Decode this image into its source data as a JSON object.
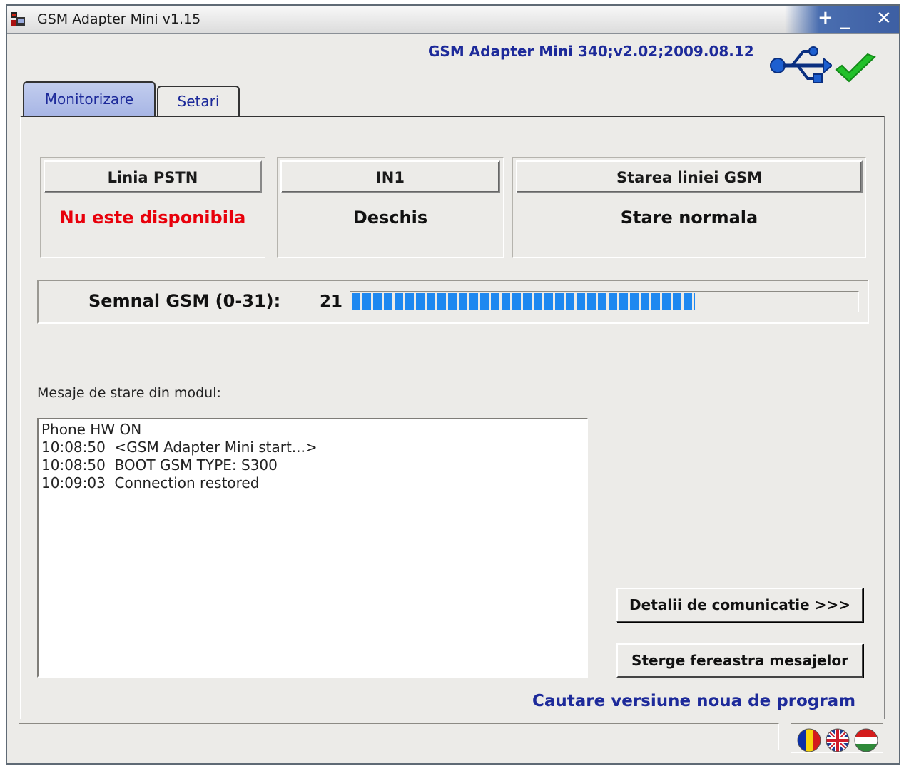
{
  "window": {
    "title": "GSM Adapter Mini v1.15",
    "controls": {
      "plus": "+",
      "minimize": "_",
      "close": "✕"
    }
  },
  "header": {
    "version_info": "GSM Adapter Mini 340;v2.02;2009.08.12",
    "connection_icon": "usb-icon",
    "status_icon": "checkmark-icon"
  },
  "tabs": [
    {
      "label": "Monitorizare",
      "active": true
    },
    {
      "label": "Setari",
      "active": false
    }
  ],
  "status_boxes": {
    "pstn": {
      "header": "Linia PSTN",
      "value": "Nu este disponibila",
      "value_color": "#e8000b"
    },
    "in1": {
      "header": "IN1",
      "value": "Deschis",
      "value_color": "#111111"
    },
    "gsm": {
      "header": "Starea liniei GSM",
      "value": "Stare normala",
      "value_color": "#111111"
    }
  },
  "signal": {
    "label": "Semnal GSM (0-31):",
    "value_text": "21",
    "level": 21,
    "max": 31,
    "bar_fraction": 0.68,
    "bar_color": "#1e88f0"
  },
  "messages": {
    "label": "Mesaje de stare din modul:",
    "lines": [
      "Phone HW ON",
      "10:08:50  <GSM Adapter Mini start...>",
      "10:08:50  BOOT GSM TYPE: S300",
      "10:09:03  Connection restored"
    ]
  },
  "buttons": {
    "detalii": "Detalii de comunicatie >>>",
    "sterge": "Sterge fereastra mesajelor"
  },
  "update_link": "Cautare versiune noua de program",
  "statusbar": {
    "text": ""
  },
  "languages": [
    {
      "name": "romanian-flag-icon"
    },
    {
      "name": "uk-flag-icon"
    },
    {
      "name": "hungarian-flag-icon"
    }
  ]
}
